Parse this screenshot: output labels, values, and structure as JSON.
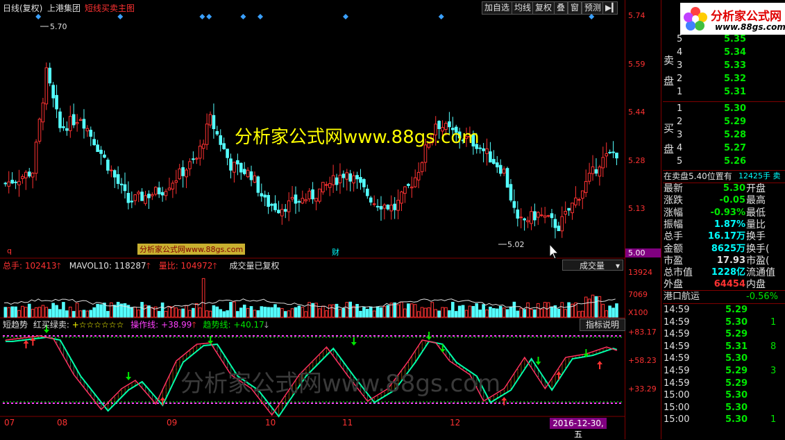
{
  "topbar": {
    "period": "日线(复权)",
    "stock_name": "上港集团",
    "formula": "短线买卖主图",
    "buttons": [
      "加自选",
      "均线",
      "复权",
      "叠",
      "窗",
      "预测"
    ]
  },
  "price_axis": {
    "ticks": [
      "5.74",
      "5.59",
      "5.44",
      "5.28",
      "5.13",
      "5.00"
    ]
  },
  "chart_annotations": {
    "high_label": "5.70",
    "low_label": "5.02",
    "q_marker": "q",
    "cai_marker": "财"
  },
  "watermark_main": "分析家公式网www.88gs.com",
  "watermark_badge": "分析家公式网www.88gs.com",
  "watermark_indicator": "分析家公式网www.88gs.com",
  "volume": {
    "total_label": "总手: 102413",
    "mavol_label": "MAVOL10: 118287",
    "ratio_label": "量比: 104972",
    "note": "成交量已复权",
    "dropdown": "成交量",
    "axis_ticks": [
      "13924",
      "7069",
      "X100"
    ]
  },
  "indicator": {
    "name": "短趋势",
    "signal_label": "红买绿卖:",
    "stars": "+☆☆☆☆☆☆",
    "op_label": "操作线: +38.99",
    "trend_label": "趋势线: +40.17",
    "explain_button": "指标说明",
    "axis_ticks": [
      "+83.17",
      "+58.23",
      "+33.29"
    ]
  },
  "x_axis": {
    "labels": [
      "07",
      "08",
      "09",
      "10",
      "11",
      "12"
    ],
    "date_badge": "2016-12-30,五"
  },
  "right_panel": {
    "logo_text": "分析家公式网",
    "logo_url": "www.88gs.com",
    "sell_label": [
      "卖",
      "盘"
    ],
    "buy_label": [
      "买",
      "盘"
    ],
    "sell": [
      {
        "lvl": "5",
        "price": "5.35"
      },
      {
        "lvl": "4",
        "price": "5.34"
      },
      {
        "lvl": "3",
        "price": "5.33"
      },
      {
        "lvl": "2",
        "price": "5.32"
      },
      {
        "lvl": "1",
        "price": "5.31"
      }
    ],
    "buy": [
      {
        "lvl": "1",
        "price": "5.30"
      },
      {
        "lvl": "2",
        "price": "5.29"
      },
      {
        "lvl": "3",
        "price": "5.28"
      },
      {
        "lvl": "4",
        "price": "5.27"
      },
      {
        "lvl": "5",
        "price": "5.26"
      }
    ],
    "position_line": "在卖盘5.40位置有",
    "position_qty": "12425手 卖",
    "stats": [
      {
        "label": "最新",
        "value": "5.30",
        "label2": "开盘"
      },
      {
        "label": "涨跌",
        "value": "-0.05",
        "label2": "最高"
      },
      {
        "label": "涨幅",
        "value": "-0.93%",
        "label2": "最低"
      },
      {
        "label": "振幅",
        "value": "1.87%",
        "label2": "量比"
      },
      {
        "label": "总手",
        "value": "16.17万",
        "label2": "换手"
      },
      {
        "label": "金额",
        "value": "8625万",
        "label2": "换手("
      },
      {
        "label": "市盈",
        "value": "17.93",
        "label2": "市盈("
      },
      {
        "label": "总市值",
        "value": "1228亿",
        "label2": "流通值"
      },
      {
        "label": "外盘",
        "value": "64454",
        "label2": "内盘"
      }
    ],
    "sector_name": "港口航运",
    "sector_change": "-0.56%",
    "ticks": [
      {
        "time": "14:59",
        "price": "5.29",
        "vol": ""
      },
      {
        "time": "14:59",
        "price": "5.30",
        "vol": "1"
      },
      {
        "time": "14:59",
        "price": "5.29",
        "vol": ""
      },
      {
        "time": "14:59",
        "price": "5.31",
        "vol": "8"
      },
      {
        "time": "14:59",
        "price": "5.30",
        "vol": ""
      },
      {
        "time": "14:59",
        "price": "5.29",
        "vol": "3"
      },
      {
        "time": "14:59",
        "price": "5.29",
        "vol": ""
      },
      {
        "time": "15:00",
        "price": "5.30",
        "vol": ""
      },
      {
        "time": "15:00",
        "price": "5.30",
        "vol": ""
      },
      {
        "time": "15:00",
        "price": "5.30",
        "vol": "1"
      }
    ]
  },
  "colors": {
    "up": "#ff3232",
    "down": "#54ffff",
    "bg": "#000000",
    "axis": "#800000",
    "grid_dot": "#ff40ff",
    "green_dot": "#00ff00"
  }
}
